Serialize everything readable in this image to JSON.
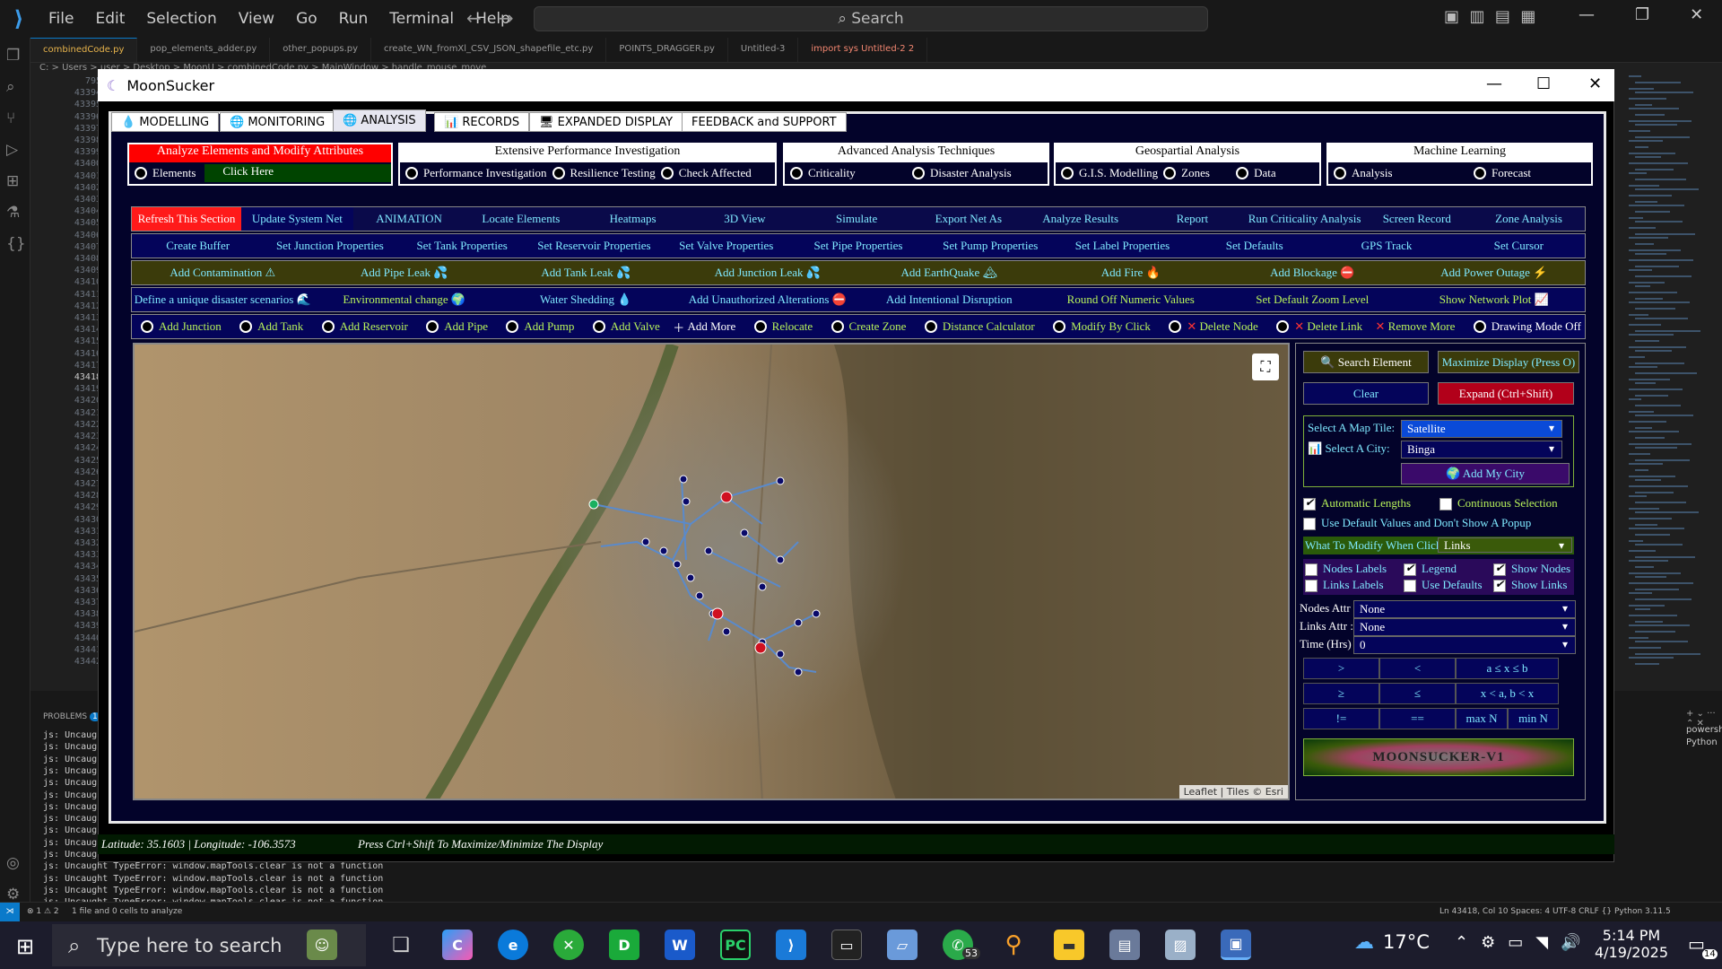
{
  "vscode": {
    "menus": [
      "File",
      "Edit",
      "Selection",
      "View",
      "Go",
      "Run",
      "Terminal",
      "Help"
    ],
    "search": "Search",
    "tabs": [
      {
        "label": "combinedCode.py",
        "state": "active"
      },
      {
        "label": "pop_elements_adder.py",
        "state": ""
      },
      {
        "label": "other_popups.py",
        "state": ""
      },
      {
        "label": "create_WN_fromXl_CSV_JSON_shapefile_etc.py",
        "state": ""
      },
      {
        "label": "POINTS_DRAGGER.py",
        "state": ""
      },
      {
        "label": "Untitled-3",
        "state": ""
      },
      {
        "label": "import sys  Untitled-2 2",
        "state": "mod"
      }
    ],
    "breadcrumb": "C: > Users > user > Desktop > MoonU > combinedCode.py > MainWindow > handle_mouse_move",
    "line_numbers": [
      "795",
      "43394",
      "43395",
      "43396",
      "43397",
      "43398",
      "43399",
      "43400",
      "43401",
      "43402",
      "43403",
      "43404",
      "43405",
      "43406",
      "43407",
      "43408",
      "43409",
      "43410",
      "43411",
      "43412",
      "43413",
      "43414",
      "43415",
      "43416",
      "43417",
      "43418",
      "43419",
      "43420",
      "43421",
      "43422",
      "43423",
      "43424",
      "43425",
      "43426",
      "43427",
      "43428",
      "43429",
      "43430",
      "43431",
      "43432",
      "43433",
      "43434",
      "43435",
      "43436",
      "43437",
      "43438",
      "43439",
      "43440",
      "43441",
      "43442"
    ],
    "problems_label": "PROBLEMS",
    "problems_count": "1",
    "terminal_lines": [
      "js: Uncaught",
      "js: Uncaught",
      "js: Uncaught",
      "js: Uncaught",
      "js: Uncaught",
      "js: Uncaught",
      "js: Uncaught",
      "js: Uncaught",
      "js: Uncaught",
      "js: Uncaught",
      "js: Uncaught",
      "js: Uncaught TypeError: window.mapTools.clear is not a function",
      "js: Uncaught TypeError: window.mapTools.clear is not a function",
      "js: Uncaught TypeError: window.mapTools.clear is not a function",
      "js: Uncaught TypeError: window.mapTools.clear is not a function"
    ],
    "terminal_list": [
      "powershell",
      "Python"
    ],
    "status_left": "⊗ 1 ⚠ 2",
    "status_msg": "1 file and 0 cells to analyze",
    "status_right": "Ln 43418, Col 10   Spaces: 4   UTF-8   CRLF   {} Python   3.11.5"
  },
  "app": {
    "title": "MoonSucker",
    "tabs": [
      "MODELLING",
      "MONITORING",
      "ANALYSIS",
      "RECORDS",
      "EXPANDED DISPLAY",
      "FEEDBACK and SUPPORT"
    ],
    "groups": [
      {
        "title": "Analyze Elements and Modify Attributes",
        "items": [
          "Elements",
          "Click Here"
        ]
      },
      {
        "title": "Extensive Performance Investigation",
        "items": [
          "Performance Investigation",
          "Resilience Testing",
          "Check Affected"
        ]
      },
      {
        "title": "Advanced Analysis Techniques",
        "items": [
          "Criticality",
          "Disaster Analysis"
        ]
      },
      {
        "title": "Geospartial Analysis",
        "items": [
          "G.I.S. Modelling",
          "Zones",
          "Data"
        ]
      },
      {
        "title": "Machine Learning",
        "items": [
          "Analysis",
          "Forecast"
        ]
      }
    ],
    "row1": [
      "Refresh This Section",
      "Update System Net",
      "ANIMATION",
      "Locate Elements",
      "Heatmaps",
      "3D View",
      "Simulate",
      "Export Net As",
      "Analyze Results",
      "Report",
      "Run Criticality Analysis",
      "Screen Record",
      "Zone Analysis"
    ],
    "row2": [
      "Create Buffer",
      "Set Junction Properties",
      "Set Tank Properties",
      "Set Reservoir Properties",
      "Set Valve Properties",
      "Set Pipe Properties",
      "Set Pump Properties",
      "Set Label Properties",
      "Set Defaults",
      "GPS Track",
      "Set Cursor"
    ],
    "row3": [
      "Add Contamination ⚠",
      "Add Pipe Leak 💦",
      "Add Tank Leak 💦",
      "Add Junction Leak 💦",
      "Add EarthQuake 🏔",
      "Add Fire 🔥",
      "Add Blockage ⛔",
      "Add Power Outage ⚡"
    ],
    "row4": [
      "Define a unique disaster scenarios 🌊",
      "Environmental change 🌍",
      "Water Shedding 💧",
      "Add Unauthorized Alterations ⛔",
      "Add Intentional Disruption",
      "Round Off Numeric Values",
      "Set Default Zoom Level",
      "Show Network Plot 📈"
    ],
    "row5": [
      "Add Junction",
      "Add Tank",
      "Add Reservoir",
      "Add Pipe",
      "Add Pump",
      "Add Valve",
      "Add More",
      "Relocate",
      "Create Zone",
      "Distance Calculator",
      "Modify By Click",
      "Delete Node",
      "Delete Link",
      "Remove More",
      "Drawing Mode Off"
    ],
    "map_attribution": "Leaflet | Tiles © Esri",
    "side": {
      "search": "🔍 Search Element",
      "maximize": "Maximize Display (Press O)",
      "clear": "Clear",
      "expand": "Expand (Ctrl+Shift)",
      "tile_label": "Select A Map Tile:",
      "tile_value": "Satellite",
      "city_label": "Select A City:",
      "city_value": "Binga",
      "add_city": "🌍 Add My City",
      "auto_lengths": "Automatic Lengths",
      "continuous": "Continuous Selection",
      "use_default": "Use Default Values and Don't Show  A Popup",
      "modify_label": "What To Modify When Clicked:",
      "modify_value": "Links",
      "nodes_labels": "Nodes Labels",
      "legend": "Legend",
      "show_nodes": "Show Nodes",
      "links_labels": "Links Labels",
      "use_defaults": "Use Defaults",
      "show_links": "Show Links",
      "nodes_attr_label": "Nodes Attr :",
      "nodes_attr": "None",
      "links_attr_label": "Links Attr :",
      "links_attr": "None",
      "time_label": "Time (Hrs) :",
      "time_value": "0",
      "ops": [
        ">",
        "<",
        "a ≤ x ≤ b",
        "≥",
        "≤",
        "x < a, b < x",
        "!=",
        "==",
        "max N",
        "min N"
      ],
      "brand": "MOONSUCKER-V1"
    },
    "status": {
      "coords": "Latitude: 35.1603 | Longitude: -106.3573",
      "hint": "Press Ctrl+Shift  To Maximize/Minimize The Display"
    }
  },
  "taskbar": {
    "search": "Type here to search",
    "badge": "53",
    "weather": "17°C",
    "time": "5:14 PM",
    "date": "4/19/2025",
    "notif": "14"
  }
}
